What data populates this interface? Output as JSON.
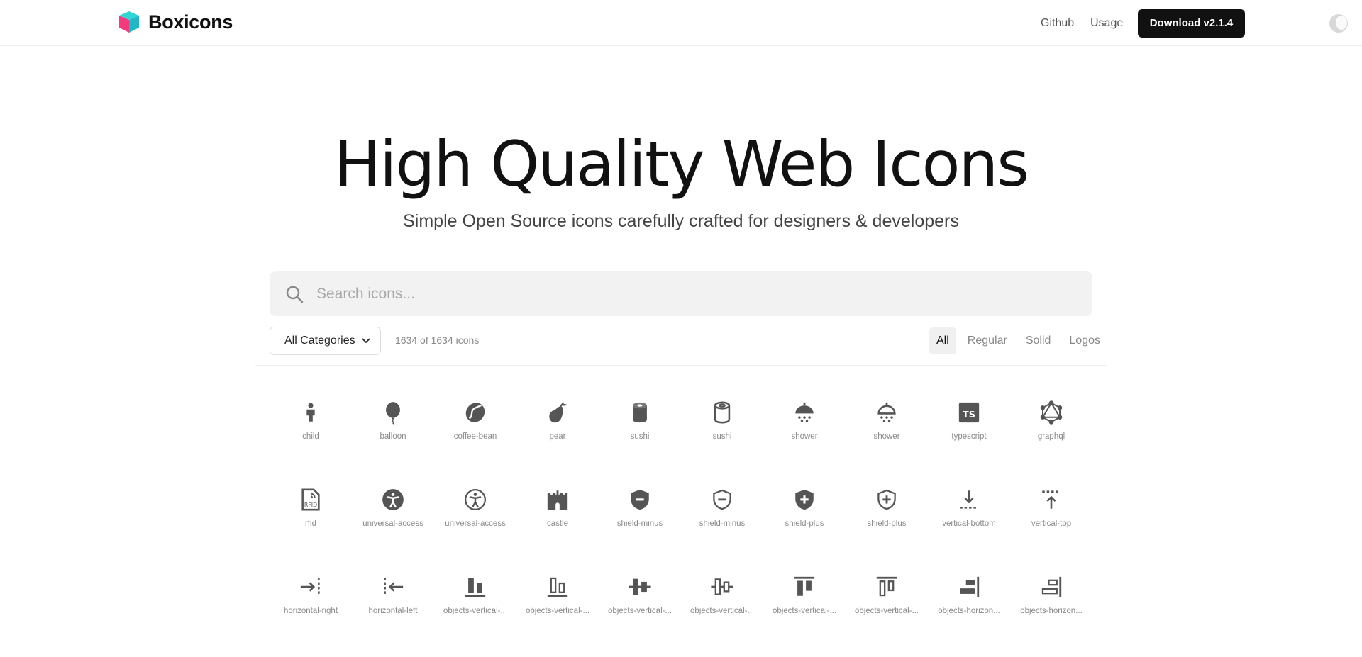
{
  "header": {
    "logo_text": "Boxicons",
    "nav": [
      {
        "label": "Github"
      },
      {
        "label": "Usage"
      }
    ],
    "download_label": "Download v2.1.4"
  },
  "hero": {
    "title": "High Quality Web Icons",
    "subtitle": "Simple Open Source icons carefully crafted for designers & developers"
  },
  "search": {
    "placeholder": "Search icons...",
    "value": ""
  },
  "filters": {
    "category": "All Categories",
    "count": "1634 of 1634 icons",
    "tabs": [
      {
        "label": "All",
        "active": true
      },
      {
        "label": "Regular",
        "active": false
      },
      {
        "label": "Solid",
        "active": false
      },
      {
        "label": "Logos",
        "active": false
      }
    ]
  },
  "colors": {
    "icon": "#555555",
    "logo_cyan": "#2fd6d3",
    "logo_pink": "#f53b7d",
    "download_bg": "#111111"
  },
  "icons": [
    {
      "name": "child",
      "icon": "child-icon"
    },
    {
      "name": "balloon",
      "icon": "balloon-icon"
    },
    {
      "name": "coffee-bean",
      "icon": "coffee-bean-icon"
    },
    {
      "name": "pear",
      "icon": "pear-icon"
    },
    {
      "name": "sushi",
      "icon": "sushi-solid-icon"
    },
    {
      "name": "sushi",
      "icon": "sushi-regular-icon"
    },
    {
      "name": "shower",
      "icon": "shower-solid-icon"
    },
    {
      "name": "shower",
      "icon": "shower-regular-icon"
    },
    {
      "name": "typescript",
      "icon": "typescript-icon"
    },
    {
      "name": "graphql",
      "icon": "graphql-icon"
    },
    {
      "name": "rfid",
      "icon": "rfid-icon"
    },
    {
      "name": "universal-access",
      "icon": "universal-access-solid-icon"
    },
    {
      "name": "universal-access",
      "icon": "universal-access-regular-icon"
    },
    {
      "name": "castle",
      "icon": "castle-icon"
    },
    {
      "name": "shield-minus",
      "icon": "shield-minus-solid-icon"
    },
    {
      "name": "shield-minus",
      "icon": "shield-minus-regular-icon"
    },
    {
      "name": "shield-plus",
      "icon": "shield-plus-solid-icon"
    },
    {
      "name": "shield-plus",
      "icon": "shield-plus-regular-icon"
    },
    {
      "name": "vertical-bottom",
      "icon": "vertical-bottom-icon"
    },
    {
      "name": "vertical-top",
      "icon": "vertical-top-icon"
    },
    {
      "name": "horizontal-right",
      "icon": "horizontal-right-icon"
    },
    {
      "name": "horizontal-left",
      "icon": "horizontal-left-icon"
    },
    {
      "name": "objects-vertical-...",
      "icon": "objects-vertical-bottom-solid-icon"
    },
    {
      "name": "objects-vertical-...",
      "icon": "objects-vertical-bottom-regular-icon"
    },
    {
      "name": "objects-vertical-...",
      "icon": "objects-vertical-center-solid-icon"
    },
    {
      "name": "objects-vertical-...",
      "icon": "objects-vertical-center-regular-icon"
    },
    {
      "name": "objects-vertical-...",
      "icon": "objects-vertical-top-solid-icon"
    },
    {
      "name": "objects-vertical-...",
      "icon": "objects-vertical-top-regular-icon"
    },
    {
      "name": "objects-horizon...",
      "icon": "objects-horizontal-right-solid-icon"
    },
    {
      "name": "objects-horizon...",
      "icon": "objects-horizontal-right-regular-icon"
    }
  ]
}
